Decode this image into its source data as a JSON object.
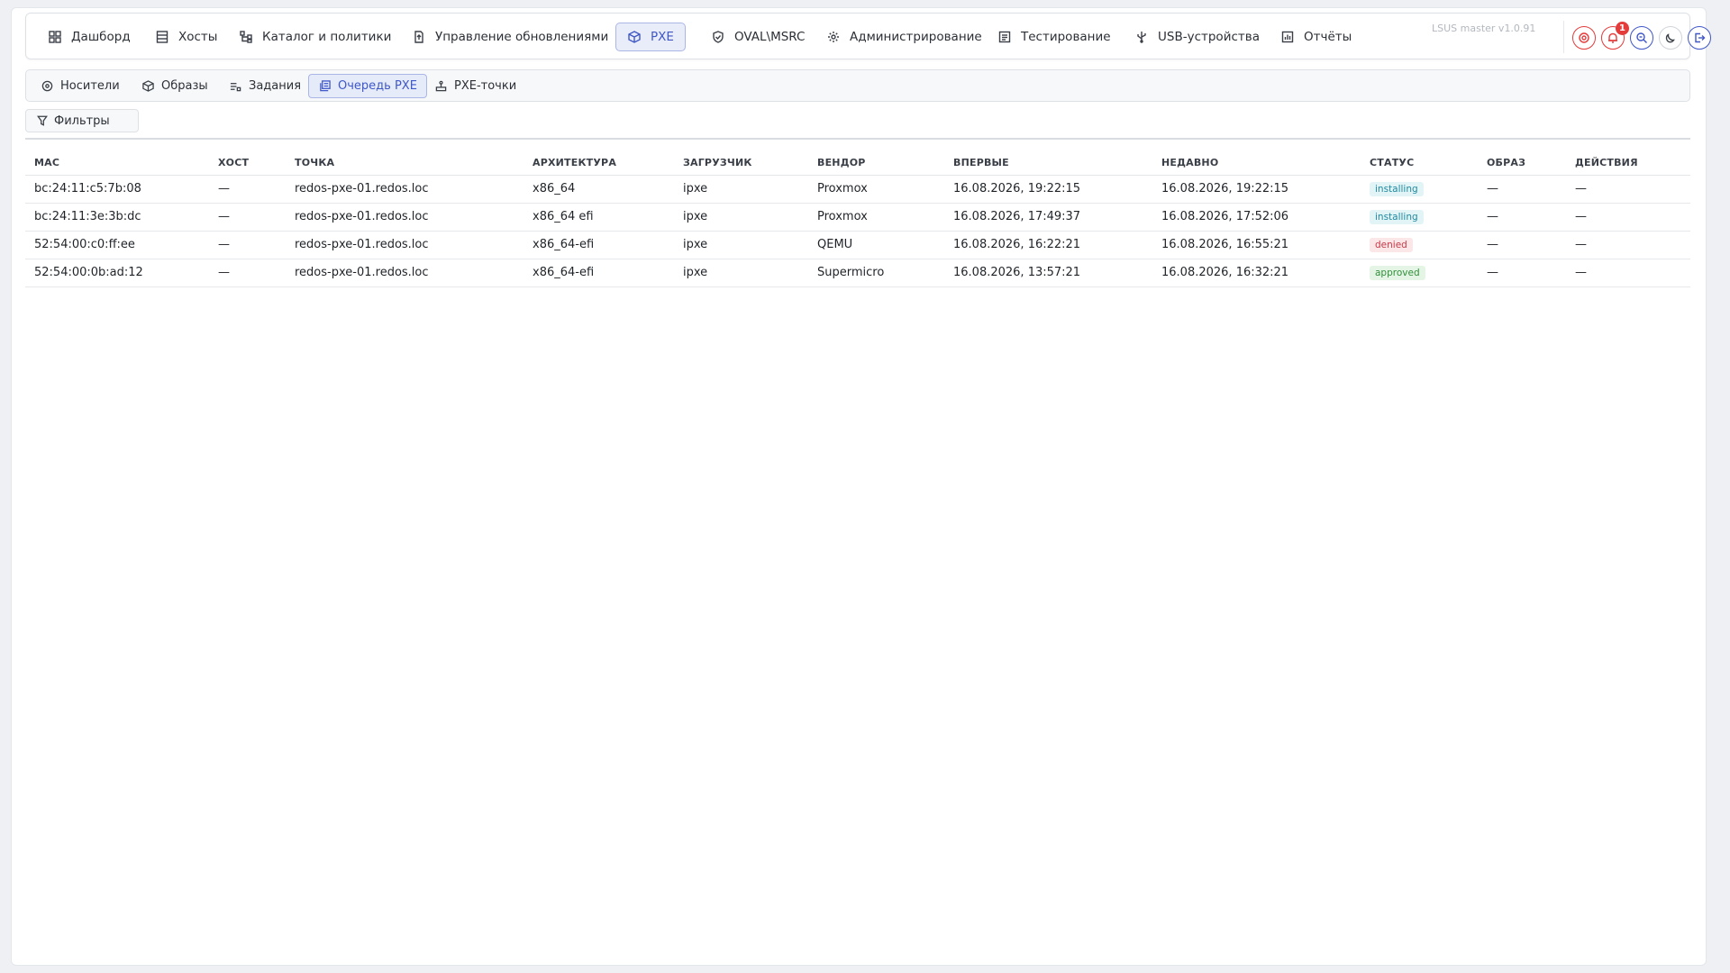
{
  "app": {
    "version": "LSUS master v1.0.91",
    "notification_count": "1"
  },
  "nav": {
    "items": [
      {
        "label": "Дашборд",
        "icon": "dashboard-icon"
      },
      {
        "label": "Хосты",
        "icon": "server-icon"
      },
      {
        "label": "Каталог и политики",
        "icon": "hierarchy-icon"
      },
      {
        "label": "Управление обновлениями",
        "icon": "file-update-icon"
      },
      {
        "label": "PXE",
        "icon": "box-icon",
        "active": true
      },
      {
        "label": "OVAL\\MSRC",
        "icon": "shield-check-icon"
      },
      {
        "label": "Администрирование",
        "icon": "settings-icon"
      },
      {
        "label": "Тестирование",
        "icon": "test-report-icon"
      },
      {
        "label": "USB-устройства",
        "icon": "usb-icon"
      },
      {
        "label": "Отчёты",
        "icon": "report-icon"
      }
    ]
  },
  "subnav": {
    "items": [
      {
        "label": "Носители",
        "icon": "disc-icon"
      },
      {
        "label": "Образы",
        "icon": "box-icon"
      },
      {
        "label": "Задания",
        "icon": "tasks-icon"
      },
      {
        "label": "Очередь PXE",
        "icon": "queue-icon",
        "active": true
      },
      {
        "label": "PXE-точки",
        "icon": "network-node-icon"
      }
    ]
  },
  "filters": {
    "label": "Фильтры"
  },
  "table": {
    "headers": [
      "MAC",
      "ХОСТ",
      "ТОЧКА",
      "АРХИТЕКТУРА",
      "ЗАГРУЗЧИК",
      "ВЕНДОР",
      "ВПЕРВЫЕ",
      "НЕДАВНО",
      "СТАТУС",
      "ОБРАЗ",
      "ДЕЙСТВИЯ"
    ],
    "rows": [
      {
        "mac": "bc:24:11:c5:7b:08",
        "host": "—",
        "point": "redos-pxe-01.redos.loc",
        "arch": "x86_64",
        "loader": "ipxe",
        "vendor": "Proxmox",
        "first": "16.08.2026, 19:22:15",
        "recent": "16.08.2026, 19:22:15",
        "status": "installing",
        "image": "—",
        "actions": "—"
      },
      {
        "mac": "bc:24:11:3e:3b:dc",
        "host": "—",
        "point": "redos-pxe-01.redos.loc",
        "arch": "x86_64 efi",
        "loader": "ipxe",
        "vendor": "Proxmox",
        "first": "16.08.2026, 17:49:37",
        "recent": "16.08.2026, 17:52:06",
        "status": "installing",
        "image": "—",
        "actions": "—"
      },
      {
        "mac": "52:54:00:c0:ff:ee",
        "host": "—",
        "point": "redos-pxe-01.redos.loc",
        "arch": "x86_64-efi",
        "loader": "ipxe",
        "vendor": "QEMU",
        "first": "16.08.2026, 16:22:21",
        "recent": "16.08.2026, 16:55:21",
        "status": "denied",
        "image": "—",
        "actions": "—"
      },
      {
        "mac": "52:54:00:0b:ad:12",
        "host": "—",
        "point": "redos-pxe-01.redos.loc",
        "arch": "x86_64-efi",
        "loader": "ipxe",
        "vendor": "Supermicro",
        "first": "16.08.2026, 13:57:21",
        "recent": "16.08.2026, 16:32:21",
        "status": "approved",
        "image": "—",
        "actions": "—"
      }
    ]
  },
  "colors": {
    "accent": "#3f57c7",
    "status_installing": "#1f8aa0",
    "status_denied": "#c83a48",
    "status_approved": "#2f8f3a",
    "icon_red": "#e43b3b",
    "icon_blue": "#3f57c7"
  }
}
